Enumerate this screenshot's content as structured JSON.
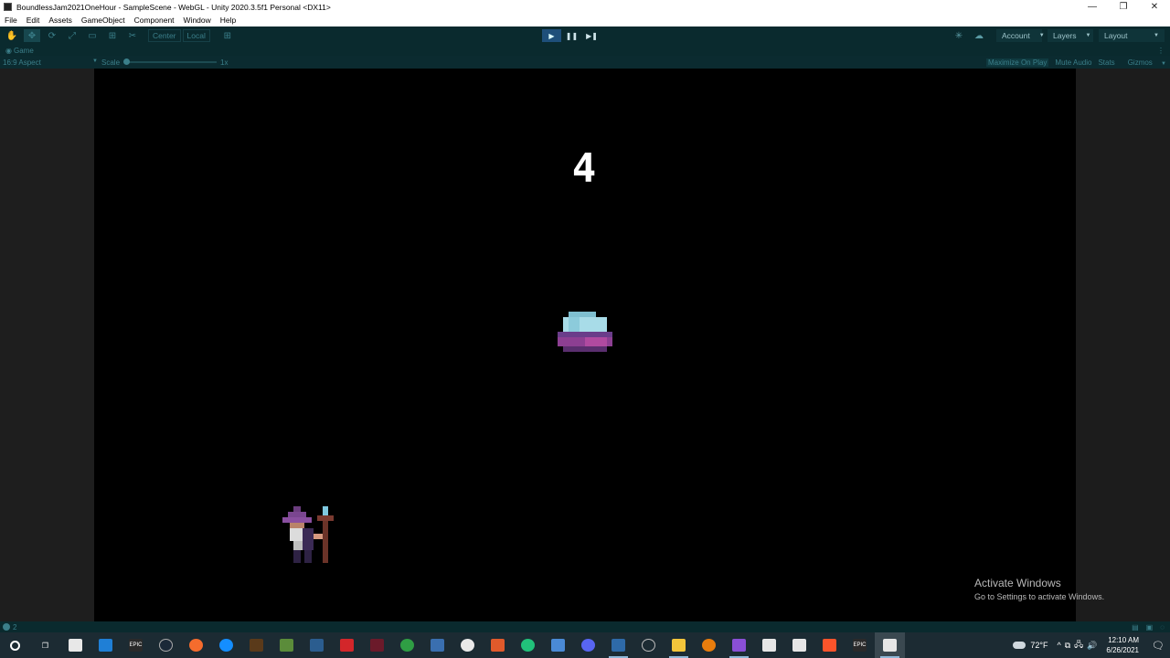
{
  "window": {
    "title": "BoundlessJam2021OneHour - SampleScene - WebGL - Unity 2020.3.5f1 Personal <DX11>",
    "controls": [
      "—",
      "❐",
      "✕"
    ]
  },
  "menu": [
    "File",
    "Edit",
    "Assets",
    "GameObject",
    "Component",
    "Window",
    "Help"
  ],
  "toolbar": {
    "tools": [
      "✋",
      "✥",
      "⟳",
      "⤢",
      "▭",
      "⊞",
      "✂"
    ],
    "pivot": "Center",
    "space": "Local",
    "grid_icon": "⊞",
    "play_controls": [
      "▶",
      "❚❚",
      "▶❚"
    ],
    "account": "Account",
    "layers": "Layers",
    "layout": "Layout"
  },
  "tab": {
    "label": "Game"
  },
  "game_toolbar": {
    "aspect": "16:9 Aspect",
    "scale_label": "Scale",
    "scale_value": "1x",
    "maximize": "Maximize On Play",
    "mute": "Mute Audio",
    "stats": "Stats",
    "gizmos": "Gizmos"
  },
  "game": {
    "score": "4"
  },
  "watermark": {
    "title": "Activate Windows",
    "subtitle": "Go to Settings to activate Windows."
  },
  "statusbar": {
    "count": "2"
  },
  "taskbar": {
    "apps": [
      {
        "name": "search",
        "glyph": "",
        "color": "#1c2b33"
      },
      {
        "name": "task-view",
        "glyph": "❒",
        "color": "#1c2b33"
      },
      {
        "name": "store",
        "glyph": "",
        "color": "#e8e8e8"
      },
      {
        "name": "mail",
        "glyph": "",
        "color": "#1f7fd6"
      },
      {
        "name": "epic",
        "glyph": "EPIC",
        "color": "#2a2a2a"
      },
      {
        "name": "steam",
        "glyph": "",
        "color": "#1b2838"
      },
      {
        "name": "origin",
        "glyph": "",
        "color": "#f56c2d"
      },
      {
        "name": "battlenet",
        "glyph": "",
        "color": "#148eff"
      },
      {
        "name": "app-brown",
        "glyph": "",
        "color": "#5a3a1a"
      },
      {
        "name": "minecraft",
        "glyph": "",
        "color": "#5b8c3a"
      },
      {
        "name": "app-blue",
        "glyph": "",
        "color": "#2b5d8f"
      },
      {
        "name": "app-red",
        "glyph": "",
        "color": "#d3262a"
      },
      {
        "name": "app-maroon",
        "glyph": "",
        "color": "#6b1a2a"
      },
      {
        "name": "app-green",
        "glyph": "",
        "color": "#2f9e44"
      },
      {
        "name": "photos",
        "glyph": "",
        "color": "#3a6fb0"
      },
      {
        "name": "xbox",
        "glyph": "",
        "color": "#e9e9e9"
      },
      {
        "name": "app-orange",
        "glyph": "",
        "color": "#e05a2b"
      },
      {
        "name": "app-teal",
        "glyph": "",
        "color": "#21c17a"
      },
      {
        "name": "app-paint",
        "glyph": "",
        "color": "#4a8ad6"
      },
      {
        "name": "discord",
        "glyph": "",
        "color": "#5865f2"
      },
      {
        "name": "app-settings",
        "glyph": "",
        "color": "#2e6aa8"
      },
      {
        "name": "app-circle",
        "glyph": "",
        "color": "#bbb"
      },
      {
        "name": "explorer",
        "glyph": "",
        "color": "#f3c53b"
      },
      {
        "name": "blender",
        "glyph": "",
        "color": "#e87d0d"
      },
      {
        "name": "visual-studio",
        "glyph": "",
        "color": "#8a4fd6"
      },
      {
        "name": "unity-hub",
        "glyph": "",
        "color": "#e6e6e6"
      },
      {
        "name": "twitch",
        "glyph": "",
        "color": "#e6e6e6"
      },
      {
        "name": "brave",
        "glyph": "",
        "color": "#fb542b"
      },
      {
        "name": "epic-2",
        "glyph": "EPIC",
        "color": "#2a2a2a"
      },
      {
        "name": "unity",
        "glyph": "",
        "color": "#e6e6e6"
      }
    ],
    "weather": "72°F",
    "tray_icons": [
      "^",
      "⧉",
      "🖧",
      "🔊"
    ],
    "time": "12:10 AM",
    "date": "6/26/2021"
  }
}
